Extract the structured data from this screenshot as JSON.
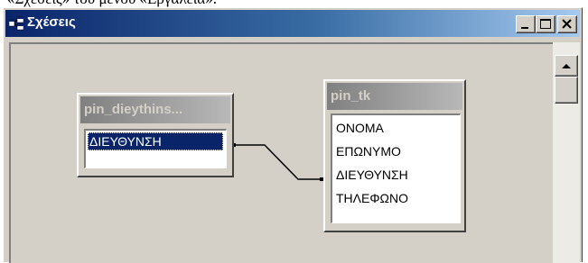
{
  "document": {
    "caption_fragment": "«Σχέσεις» του μενού «Εργαλεία»."
  },
  "window": {
    "title": "Σχέσεις",
    "icon": "relationships-icon",
    "buttons": [
      "minimize-icon",
      "maximize-icon",
      "close-icon"
    ]
  },
  "tables": [
    {
      "title": "pin_dieythins...",
      "fields": [
        "ΔΙΕΥΘΥΝΣΗ"
      ],
      "selected_field": "ΔΙΕΥΘΥΝΣΗ"
    },
    {
      "title": "pin_tk",
      "fields": [
        "ΟΝΟΜΑ",
        "ΕΠΩΝΥΜΟ",
        "ΔΙΕΥΘΥΝΣΗ",
        "ΤΗΛΕΦΩΝΟ"
      ]
    }
  ],
  "relationship": {
    "from_table": "pin_dieythins...",
    "from_field": "ΔΙΕΥΘΥΝΣΗ",
    "to_table": "pin_tk",
    "to_field": "ΔΙΕΥΘΥΝΣΗ"
  },
  "colors": {
    "titlebar_start": "#0a246a",
    "titlebar_end": "#a6caf0",
    "selection": "#0a246a",
    "face": "#d4d0c8"
  }
}
